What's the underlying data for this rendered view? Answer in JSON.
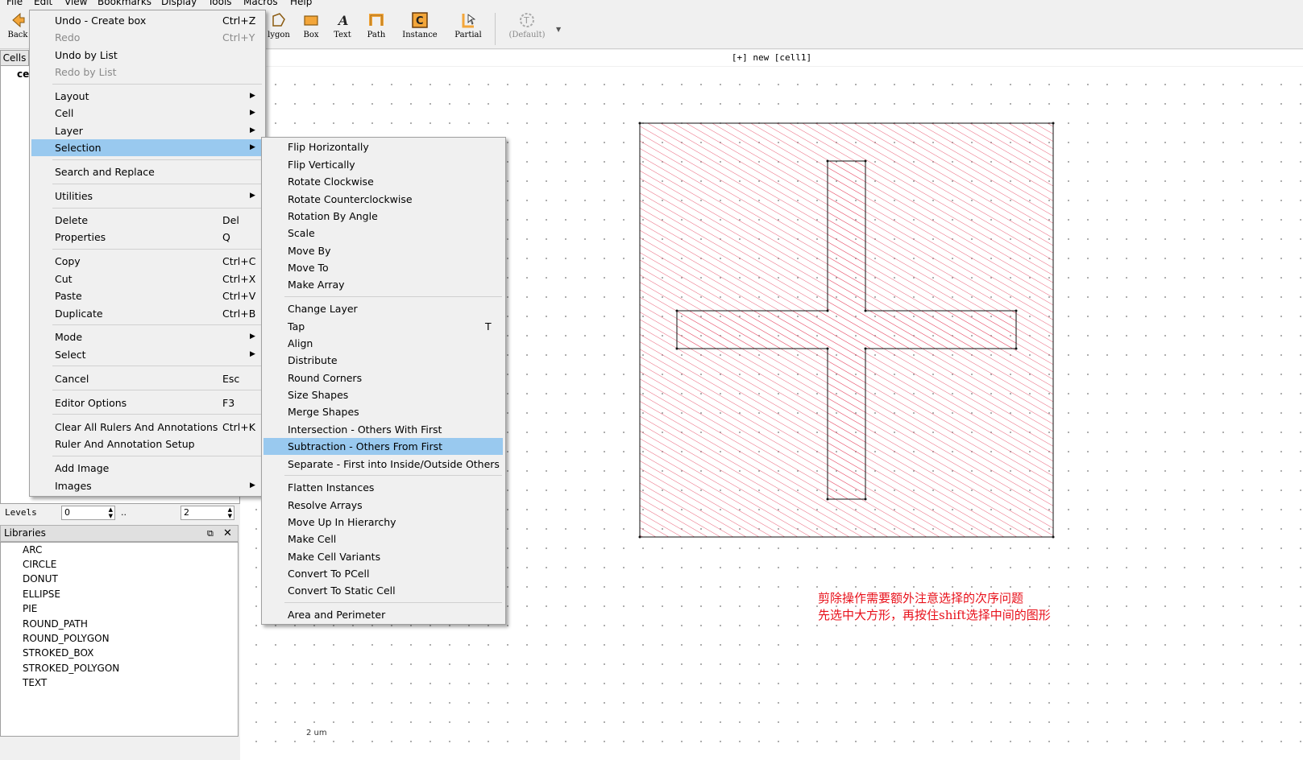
{
  "menubar": [
    "File",
    "Edit",
    "View",
    "Bookmarks",
    "Display",
    "Tools",
    "Macros",
    "Help"
  ],
  "toolbar": {
    "back": "Back",
    "polygon": "lygon",
    "box": "Box",
    "text": "Text",
    "path": "Path",
    "instance": "Instance",
    "partial": "Partial",
    "default": "(Default)"
  },
  "canvas": {
    "title": "[+] new [cell1]",
    "scale": "2 um"
  },
  "cells": {
    "tab": "Cells",
    "item": "ce"
  },
  "levels": {
    "label": "Levels",
    "from": "0",
    "dots": "..",
    "to": "2"
  },
  "libraries": {
    "title": "Libraries",
    "items": [
      "ARC",
      "CIRCLE",
      "DONUT",
      "ELLIPSE",
      "PIE",
      "ROUND_PATH",
      "ROUND_POLYGON",
      "STROKED_BOX",
      "STROKED_POLYGON",
      "TEXT"
    ]
  },
  "edit_menu": [
    {
      "label": "Undo - Create box",
      "shortcut": "Ctrl+Z"
    },
    {
      "label": "Redo",
      "shortcut": "Ctrl+Y",
      "disabled": true
    },
    {
      "label": "Undo by List"
    },
    {
      "label": "Redo by List",
      "disabled": true
    },
    {
      "label": "Layout",
      "submenu": true
    },
    {
      "label": "Cell",
      "submenu": true
    },
    {
      "label": "Layer",
      "submenu": true
    },
    {
      "label": "Selection",
      "submenu": true,
      "highlighted": true
    },
    {
      "label": "Search and Replace"
    },
    {
      "label": "Utilities",
      "submenu": true
    },
    {
      "label": "Delete",
      "shortcut": "Del"
    },
    {
      "label": "Properties",
      "shortcut": "Q"
    },
    {
      "label": "Copy",
      "shortcut": "Ctrl+C"
    },
    {
      "label": "Cut",
      "shortcut": "Ctrl+X"
    },
    {
      "label": "Paste",
      "shortcut": "Ctrl+V"
    },
    {
      "label": "Duplicate",
      "shortcut": "Ctrl+B"
    },
    {
      "label": "Mode",
      "submenu": true
    },
    {
      "label": "Select",
      "submenu": true
    },
    {
      "label": "Cancel",
      "shortcut": "Esc"
    },
    {
      "label": "Editor Options",
      "shortcut": "F3"
    },
    {
      "label": "Clear All Rulers And Annotations",
      "shortcut": "Ctrl+K"
    },
    {
      "label": "Ruler And Annotation Setup"
    },
    {
      "label": "Add Image"
    },
    {
      "label": "Images",
      "submenu": true
    }
  ],
  "selection_menu": [
    {
      "label": "Flip Horizontally"
    },
    {
      "label": "Flip Vertically"
    },
    {
      "label": "Rotate Clockwise"
    },
    {
      "label": "Rotate Counterclockwise"
    },
    {
      "label": "Rotation By Angle"
    },
    {
      "label": "Scale"
    },
    {
      "label": "Move By"
    },
    {
      "label": "Move To"
    },
    {
      "label": "Make Array"
    },
    {
      "label": "Change Layer"
    },
    {
      "label": "Tap",
      "shortcut": "T"
    },
    {
      "label": "Align"
    },
    {
      "label": "Distribute"
    },
    {
      "label": "Round Corners"
    },
    {
      "label": "Size Shapes"
    },
    {
      "label": "Merge Shapes"
    },
    {
      "label": "Intersection - Others With First"
    },
    {
      "label": "Subtraction - Others From First",
      "highlighted": true
    },
    {
      "label": "Separate - First into Inside/Outside Others"
    },
    {
      "label": "Flatten Instances"
    },
    {
      "label": "Resolve Arrays"
    },
    {
      "label": "Move Up In Hierarchy"
    },
    {
      "label": "Make Cell"
    },
    {
      "label": "Make Cell Variants"
    },
    {
      "label": "Convert To PCell"
    },
    {
      "label": "Convert To Static Cell"
    },
    {
      "label": "Area and Perimeter"
    }
  ],
  "note": {
    "line1": "剪除操作需要额外注意选择的次序问题",
    "line2": "先选中大方形，再按住shift选择中间的图形",
    "color": "#e8101a"
  },
  "colors": {
    "highlight": "#99c9ef",
    "hatch": "#e8506a"
  }
}
